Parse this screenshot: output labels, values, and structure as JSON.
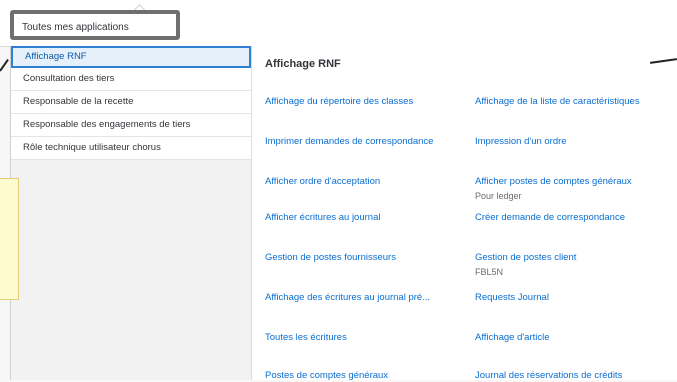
{
  "header": {
    "tab_label": "Toutes mes applications"
  },
  "sidebar": {
    "items": [
      {
        "label": "Affichage RNF"
      },
      {
        "label": "Consultation des tiers"
      },
      {
        "label": "Responsable de la recette"
      },
      {
        "label": "Responsable des engagements de tiers"
      },
      {
        "label": "Rôle technique utilisateur chorus"
      }
    ]
  },
  "content": {
    "title": "Affichage RNF",
    "apps_left": [
      {
        "label": "Affichage du répertoire des classes"
      },
      {
        "label": "Imprimer demandes de correspondance"
      },
      {
        "label": "Afficher ordre d'acceptation"
      },
      {
        "label": "Afficher écritures au journal"
      },
      {
        "label": "Gestion de postes fournisseurs"
      },
      {
        "label": "Affichage des écritures au journal pré..."
      },
      {
        "label": "Toutes les écritures"
      },
      {
        "label": "Postes de comptes généraux"
      }
    ],
    "apps_right": [
      {
        "label": "Affichage de la liste de caractéristiques"
      },
      {
        "label": "Impression d'un ordre"
      },
      {
        "label": "Afficher postes de comptes généraux",
        "subtitle": "Pour ledger"
      },
      {
        "label": "Créer demande de correspondance"
      },
      {
        "label": "Gestion de postes client",
        "subtitle": "FBL5N"
      },
      {
        "label": "Requests Journal"
      },
      {
        "label": "Affichage d'article"
      },
      {
        "label": "Journal des réservations de crédits"
      }
    ]
  },
  "colors": {
    "link": "#0a6ed1",
    "selected_border": "#2f7fd3",
    "highlight_frame": "#6f6f6f",
    "note_bg": "#fffbd0"
  }
}
